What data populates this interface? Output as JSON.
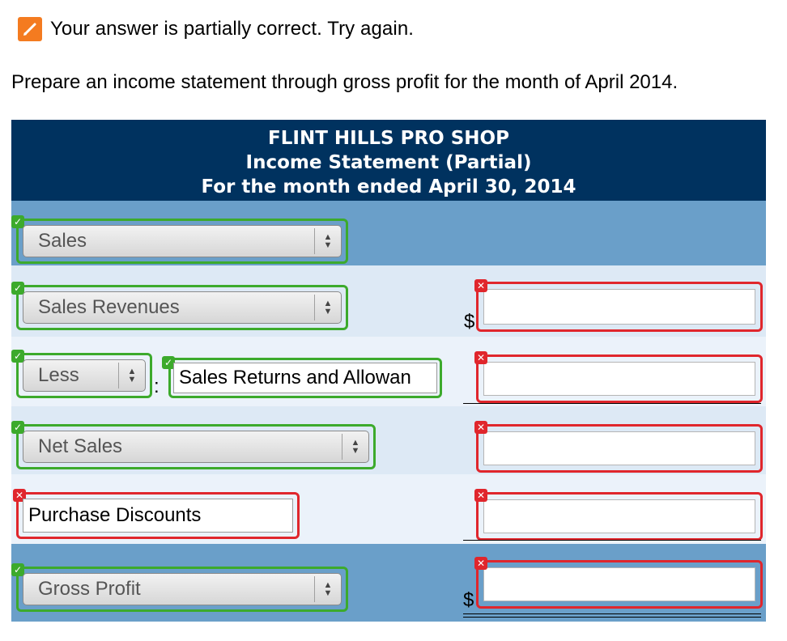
{
  "status": {
    "icon": "pencil-icon",
    "text": "Your answer is partially correct.  Try again."
  },
  "prompt": "Prepare an income statement through gross profit for the month of April 2014.",
  "statement": {
    "company": "FLINT HILLS PRO SHOP",
    "title": "Income Statement (Partial)",
    "period": "For the month ended April 30, 2014"
  },
  "rows": {
    "sales": {
      "select_value": "Sales",
      "state": "correct"
    },
    "sales_revenues": {
      "select_value": "Sales Revenues",
      "state": "correct",
      "currency": "$",
      "amount": "",
      "amount_state": "incorrect"
    },
    "less": {
      "select_value": "Less",
      "state": "correct",
      "colon": ":",
      "account": "Sales Returns and Allowan",
      "account_state": "correct",
      "amount": "",
      "amount_state": "incorrect"
    },
    "net_sales": {
      "select_value": "Net Sales",
      "state": "correct",
      "amount": "",
      "amount_state": "incorrect"
    },
    "purchase_discounts": {
      "account": "Purchase Discounts",
      "state": "incorrect",
      "amount": "",
      "amount_state": "incorrect"
    },
    "gross_profit": {
      "select_value": "Gross Profit",
      "state": "correct",
      "currency": "$",
      "amount": "",
      "amount_state": "incorrect"
    }
  },
  "colors": {
    "header_bg": "#00325f",
    "row_dark": "#6a9fc9",
    "row_light": "#dde9f5",
    "correct": "#3caa2c",
    "incorrect": "#e0262c",
    "status_icon": "#f47b20"
  }
}
